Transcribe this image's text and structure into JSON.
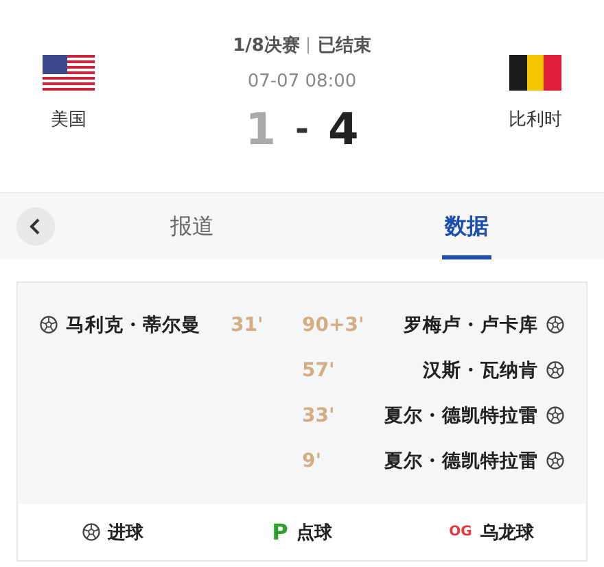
{
  "match": {
    "stage": "1/8决赛",
    "status": "已结束",
    "time": "07-07 08:00"
  },
  "teams": [
    {
      "name": "美国",
      "kind": "usa",
      "score": "1",
      "winner": false
    },
    {
      "name": "比利时",
      "kind": "belgium",
      "score": "4",
      "winner": true
    }
  ],
  "score_separator": "-",
  "tabs": [
    {
      "label": "报道",
      "selected": false
    },
    {
      "label": "数据",
      "selected": true
    }
  ],
  "home_events": [
    {
      "kind": "goal",
      "player": "马利克・蒂尔曼",
      "minute": "31'"
    }
  ],
  "away_events": [
    {
      "kind": "goal",
      "player": "罗梅卢・卢卡库",
      "minute": "90+3'"
    },
    {
      "kind": "goal",
      "player": "汉斯・瓦纳肯",
      "minute": "57'"
    },
    {
      "kind": "goal",
      "player": "夏尔・德凯特拉雷",
      "minute": "33'"
    },
    {
      "kind": "goal",
      "player": "夏尔・德凯特拉雷",
      "minute": "9'"
    }
  ],
  "legend": [
    {
      "kind": "goal",
      "label": "进球"
    },
    {
      "kind": "penalty",
      "symbol": "P",
      "label": "点球"
    },
    {
      "kind": "own_goal",
      "symbol": "OG",
      "label": "乌龙球"
    }
  ]
}
